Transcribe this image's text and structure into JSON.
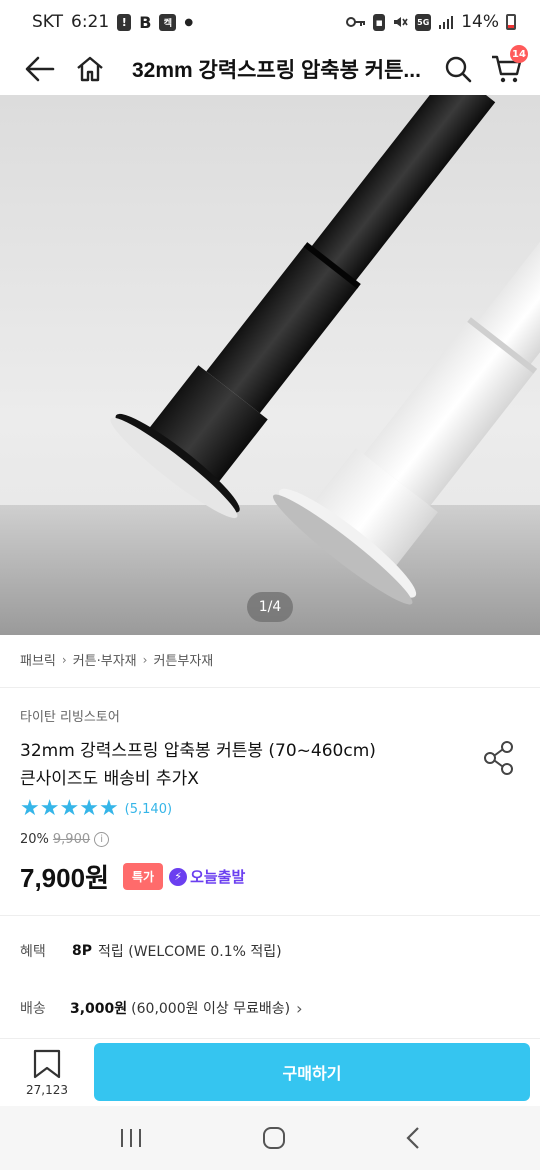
{
  "status": {
    "carrier": "SKT",
    "time": "6:21",
    "battery": "14%",
    "network": "5G",
    "icons": [
      "alert-icon",
      "b-icon",
      "app-icon",
      "dot-icon",
      "key-icon",
      "lock-icon",
      "mute-icon",
      "wifi-icon",
      "signal-icon",
      "battery-icon"
    ],
    "app_badge": "켁"
  },
  "appbar": {
    "title": "32mm 강력스프링 압축봉 커튼...",
    "cart_count": "14"
  },
  "hero": {
    "page_indicator": "1/4"
  },
  "breadcrumb": [
    "패브릭",
    "커튼·부자재",
    "커튼부자재"
  ],
  "product": {
    "brand": "타이탄 리빙스토어",
    "title_line1": "32mm 강력스프링 압축봉 커튼봉 (70~460cm)",
    "title_line2": "큰사이즈도 배송비 추가X",
    "rating_stars": 5,
    "review_count": "(5,140)",
    "discount_rate": "20%",
    "original_price": "9,900",
    "price": "7,900원",
    "special_badge": "특가",
    "today_delivery": "오늘출발"
  },
  "benefit": {
    "label": "혜택",
    "points": "8P",
    "text": "적립 (WELCOME 0.1% 적립)"
  },
  "shipping": {
    "label": "배송",
    "fee": "3,000원",
    "text": "(60,000원 이상 무료배송)"
  },
  "bottom": {
    "bookmark_count": "27,123",
    "buy_label": "구매하기"
  },
  "colors": {
    "accent": "#35c5f0",
    "rating": "#35b5e8",
    "special": "#ff6b6b",
    "today": "#6b3ff0",
    "cart_badge": "#ff5a5a"
  }
}
